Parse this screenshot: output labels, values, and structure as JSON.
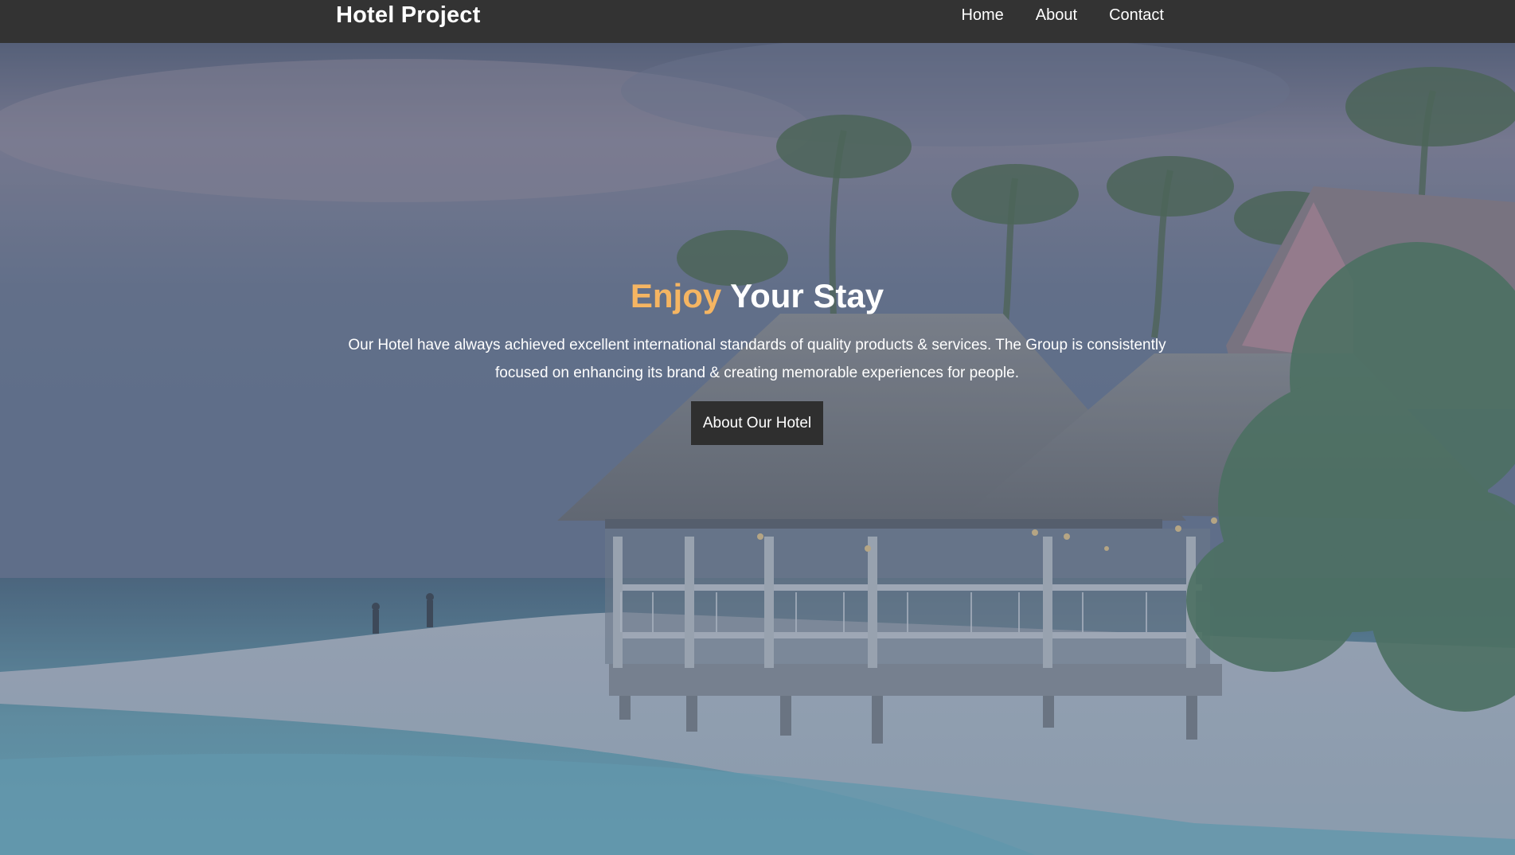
{
  "navbar": {
    "brand": "Hotel Project",
    "links": [
      {
        "label": "Home"
      },
      {
        "label": "About"
      },
      {
        "label": "Contact"
      }
    ]
  },
  "hero": {
    "title_accent": "Enjoy",
    "title_rest": "Your Stay",
    "description": "Our Hotel have always achieved excellent international standards of quality products & services. The Group is consistently focused on enhancing its brand & creating memorable experiences for people.",
    "button_label": "About Our Hotel"
  },
  "colors": {
    "navbar_bg": "#333333",
    "accent": "#f5b562",
    "button_bg": "#2f2f2f"
  }
}
